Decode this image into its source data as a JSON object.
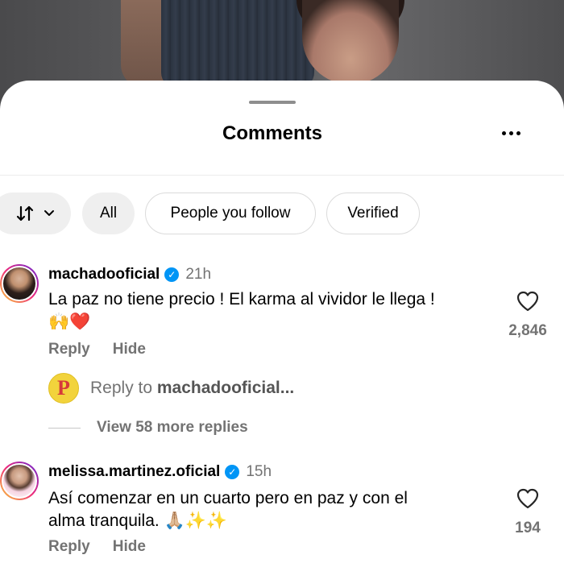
{
  "sheet": {
    "title": "Comments",
    "more_label": "More options"
  },
  "filters": {
    "sort_icon": "sort-arrows-icon",
    "chips": [
      {
        "label": "All",
        "selected": true
      },
      {
        "label": "People you follow",
        "selected": false
      },
      {
        "label": "Verified",
        "selected": false
      }
    ]
  },
  "comments": [
    {
      "username": "machadooficial",
      "verified": true,
      "timestamp": "21h",
      "text": "La paz no tiene precio ! El karma al vividor le llega !",
      "emoji": "🙌❤️",
      "likes": "2,846",
      "actions": {
        "reply": "Reply",
        "hide": "Hide"
      }
    },
    {
      "username": "melissa.martinez.oficial",
      "verified": true,
      "timestamp": "15h",
      "text_line1": "Así comenzar en un cuarto pero en paz y con el",
      "text_line2": "alma tranquila. 🙏🏼✨✨",
      "likes": "194",
      "actions": {
        "reply": "Reply",
        "hide": "Hide"
      }
    }
  ],
  "reply_box": {
    "prefix": "Reply to ",
    "target": "machadooficial..."
  },
  "view_replies": "View 58 more replies",
  "colors": {
    "verified": "#0095f6",
    "secondary_text": "#737373",
    "chip_fill": "#efefef"
  }
}
